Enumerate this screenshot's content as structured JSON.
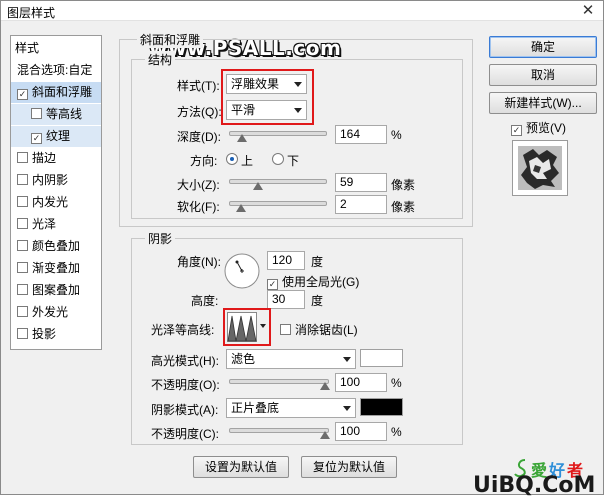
{
  "window": {
    "title": "图层样式",
    "close_glyph": "✕"
  },
  "watermark": "www.PSALL.com",
  "sidebar": {
    "header": "样式",
    "blend": "混合选项:自定",
    "items": [
      {
        "label": "斜面和浮雕",
        "checked": true
      },
      {
        "label": "等高线",
        "checked": false
      },
      {
        "label": "纹理",
        "checked": true
      },
      {
        "label": "描边",
        "checked": false
      },
      {
        "label": "内阴影",
        "checked": false
      },
      {
        "label": "内发光",
        "checked": false
      },
      {
        "label": "光泽",
        "checked": false
      },
      {
        "label": "颜色叠加",
        "checked": false
      },
      {
        "label": "渐变叠加",
        "checked": false
      },
      {
        "label": "图案叠加",
        "checked": false
      },
      {
        "label": "外发光",
        "checked": false
      },
      {
        "label": "投影",
        "checked": false
      }
    ]
  },
  "bevel": {
    "section_title": "斜面和浮雕",
    "structure_title": "结构",
    "style_label": "样式(T):",
    "style_value": "浮雕效果",
    "technique_label": "方法(Q):",
    "technique_value": "平滑",
    "depth_label": "深度(D):",
    "depth_value": "164",
    "depth_unit": "%",
    "depth_level": 0.12,
    "direction_label": "方向:",
    "dir_up": "上",
    "dir_down": "下",
    "size_label": "大小(Z):",
    "size_value": "59",
    "size_unit": "像素",
    "size_level": 0.29,
    "soften_label": "软化(F):",
    "soften_value": "2",
    "soften_unit": "像素",
    "soften_level": 0.11
  },
  "shading": {
    "title": "阴影",
    "angle_label": "角度(N):",
    "angle_value": "120",
    "angle_unit": "度",
    "global_light_label": "使用全局光(G)",
    "global_light": true,
    "altitude_label": "高度:",
    "altitude_value": "30",
    "altitude_unit": "度",
    "gloss_label": "光泽等高线:",
    "antialias_label": "消除锯齿(L)",
    "antialias": false,
    "highlight_label": "高光模式(H):",
    "highlight_mode": "滤色",
    "highlight_color": "#ffffff",
    "opacity1_label": "不透明度(O):",
    "opacity1_value": "100",
    "opacity_unit": "%",
    "shadow_label": "阴影模式(A):",
    "shadow_mode": "正片叠底",
    "shadow_color": "#000000",
    "opacity2_label": "不透明度(C):",
    "opacity2_value": "100"
  },
  "buttons": {
    "ok": "确定",
    "cancel": "取消",
    "new_style": "新建样式(W)...",
    "preview": "预览(V)",
    "make_default": "设置为默认值",
    "reset_default": "复位为默认值"
  },
  "brand": {
    "text": "UiBQ.CoM"
  },
  "colors": {
    "accent": "#e0191a",
    "selection": "#c7dcf3"
  }
}
